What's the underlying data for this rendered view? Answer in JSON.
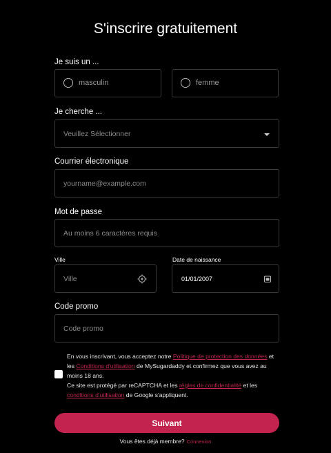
{
  "title": "S'inscrire gratuitement",
  "gender": {
    "label": "Je suis un ...",
    "options": [
      "masculin",
      "femme"
    ]
  },
  "seeking": {
    "label": "Je cherche ...",
    "placeholder": "Veuillez Sélectionner"
  },
  "email": {
    "label": "Courrier électronique",
    "placeholder": "yourname@example.com"
  },
  "password": {
    "label": "Mot de passe",
    "placeholder": "Au moins 6 caractères requis"
  },
  "city": {
    "label": "Ville",
    "placeholder": "Ville",
    "icon": "location-target-icon"
  },
  "birthdate": {
    "label": "Date de naissance",
    "value": "01/01/2007",
    "icon": "calendar-icon"
  },
  "promo": {
    "label": "Code promo",
    "placeholder": "Code promo"
  },
  "terms": {
    "t1": "En vous inscrivant, vous acceptez notre ",
    "link1": "Politique de protection des données",
    "t2": " et les ",
    "link2": "Conditions d'utilisation",
    "t3": " de MySugardaddy et confirmez que vous avez au moins 18 ans.",
    "t4": "Ce site est protégé par reCAPTCHA et les ",
    "link3": "règles de confidentialité",
    "t5": " et les ",
    "link4": "conditions d'utilisation",
    "t6": " de Google s'appliquent.",
    "checked": false
  },
  "submit_label": "Suivant",
  "login": {
    "question": "Vous êtes déjà membre?",
    "link": "Connexion"
  },
  "colors": {
    "accent": "#c2244f",
    "background": "#000000",
    "border": "#3a3a3a"
  }
}
